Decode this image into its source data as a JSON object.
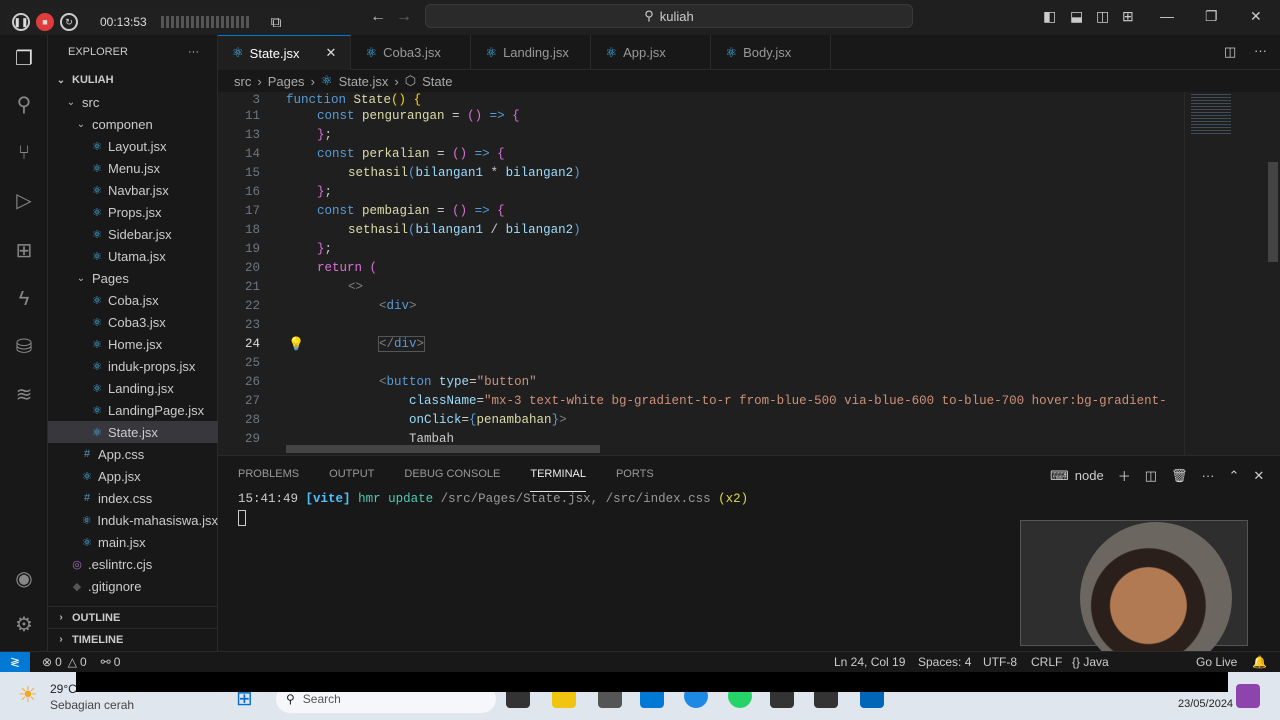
{
  "recorder": {
    "time": "00:13:53"
  },
  "title_search": "kuliah",
  "explorer": {
    "title": "EXPLORER",
    "root": "KULIAH",
    "rows": [
      {
        "label": "src",
        "depth": 1,
        "type": "folder"
      },
      {
        "label": "componen",
        "depth": 2,
        "type": "folder"
      },
      {
        "label": "Layout.jsx",
        "depth": 3,
        "type": "react"
      },
      {
        "label": "Menu.jsx",
        "depth": 3,
        "type": "react"
      },
      {
        "label": "Navbar.jsx",
        "depth": 3,
        "type": "react"
      },
      {
        "label": "Props.jsx",
        "depth": 3,
        "type": "react"
      },
      {
        "label": "Sidebar.jsx",
        "depth": 3,
        "type": "react"
      },
      {
        "label": "Utama.jsx",
        "depth": 3,
        "type": "react"
      },
      {
        "label": "Pages",
        "depth": 2,
        "type": "folder"
      },
      {
        "label": "Coba.jsx",
        "depth": 3,
        "type": "react"
      },
      {
        "label": "Coba3.jsx",
        "depth": 3,
        "type": "react"
      },
      {
        "label": "Home.jsx",
        "depth": 3,
        "type": "react"
      },
      {
        "label": "induk-props.jsx",
        "depth": 3,
        "type": "react"
      },
      {
        "label": "Landing.jsx",
        "depth": 3,
        "type": "react"
      },
      {
        "label": "LandingPage.jsx",
        "depth": 3,
        "type": "react"
      },
      {
        "label": "State.jsx",
        "depth": 3,
        "type": "react",
        "selected": true
      },
      {
        "label": "App.css",
        "depth": 2,
        "type": "css"
      },
      {
        "label": "App.jsx",
        "depth": 2,
        "type": "react"
      },
      {
        "label": "index.css",
        "depth": 2,
        "type": "css"
      },
      {
        "label": "Induk-mahasiswa.jsx",
        "depth": 2,
        "type": "react"
      },
      {
        "label": "main.jsx",
        "depth": 2,
        "type": "react"
      },
      {
        "label": ".eslintrc.cjs",
        "depth": 1,
        "type": "eslint"
      },
      {
        "label": ".gitignore",
        "depth": 1,
        "type": "git"
      }
    ],
    "outline": "OUTLINE",
    "timeline": "TIMELINE"
  },
  "tabs": [
    "State.jsx",
    "Coba3.jsx",
    "Landing.jsx",
    "App.jsx",
    "Body.jsx"
  ],
  "breadcrumb": [
    "src",
    "Pages",
    "State.jsx",
    "State"
  ],
  "code": {
    "lines": [
      "3",
      "11",
      "13",
      "14",
      "15",
      "16",
      "17",
      "18",
      "19",
      "20",
      "21",
      "22",
      "23",
      "24",
      "25",
      "26",
      "27",
      "28",
      "29"
    ],
    "current_line": "24"
  },
  "panel": {
    "tabs": [
      "PROBLEMS",
      "OUTPUT",
      "DEBUG CONSOLE",
      "TERMINAL",
      "PORTS"
    ],
    "active": "TERMINAL",
    "shell": "node",
    "log_time": "15:41:49",
    "log_tag": "[vite]",
    "log_msg": "hmr update",
    "log_paths": "/src/Pages/State.jsx, /src/index.css",
    "log_count": "(x2)"
  },
  "status": {
    "errors": "0",
    "warnings": "0",
    "ports": "0",
    "position": "Ln 24, Col 19",
    "spaces": "Spaces: 4",
    "encoding": "UTF-8",
    "eol": "CRLF",
    "lang": "{} Java",
    "golive": "Go Live"
  },
  "taskbar": {
    "temp": "29°C",
    "weather": "Sebagian cerah",
    "search": "Search",
    "date": "23/05/2024"
  }
}
